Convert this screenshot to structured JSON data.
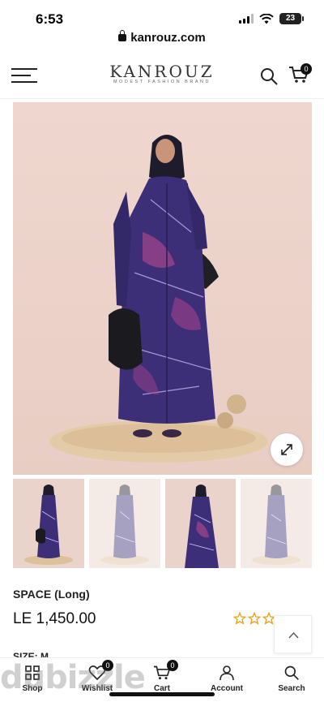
{
  "status_bar": {
    "time": "6:53",
    "battery": "23"
  },
  "browser": {
    "url": "kanrouz.com"
  },
  "header": {
    "brand": "KANROUZ",
    "tagline": "MODEST FASHION BRAND",
    "cart_count": "0"
  },
  "product": {
    "name": "SPACE (Long)",
    "price": "LE 1,450.00",
    "rating": 0,
    "size_label": "SIZE: M",
    "thumbnails": [
      "front",
      "back",
      "side",
      "back-2"
    ]
  },
  "bottom_nav": [
    {
      "label": "Shop",
      "icon": "grid-icon"
    },
    {
      "label": "Wishlist",
      "icon": "heart-icon",
      "badge": "0"
    },
    {
      "label": "Cart",
      "icon": "cart-icon",
      "badge": "0"
    },
    {
      "label": "Account",
      "icon": "user-icon"
    },
    {
      "label": "Search",
      "icon": "search-icon"
    }
  ],
  "watermark": "dubizzle",
  "colors": {
    "accent": "#e8a317",
    "dress": "#3c2f78",
    "backdrop": "#ecd4cb"
  }
}
